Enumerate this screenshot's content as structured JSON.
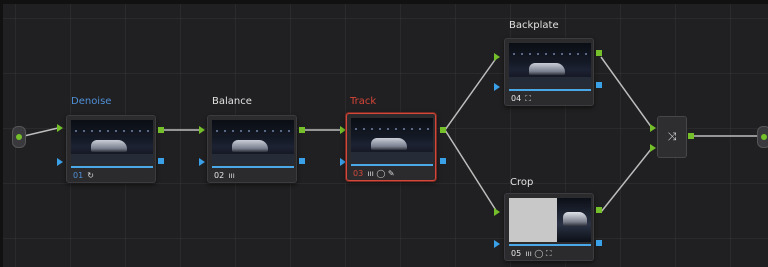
{
  "nodes": [
    {
      "label": "Denoise",
      "num": "01",
      "icon": "↻"
    },
    {
      "label": "Balance",
      "num": "02",
      "icon": "ııı"
    },
    {
      "label": "Track",
      "num": "03",
      "icon": "ııı ◯ ✎"
    },
    {
      "label": "Backplate",
      "num": "04",
      "icon": "⛶"
    },
    {
      "label": "Crop",
      "num": "05",
      "icon": "ııı ◯ ⛶"
    }
  ],
  "mixer": {
    "icon": "⤨"
  },
  "colors": {
    "accent_blue": "#4aa8e8",
    "selected_red": "#d3483a",
    "port_green": "#75c02a"
  }
}
